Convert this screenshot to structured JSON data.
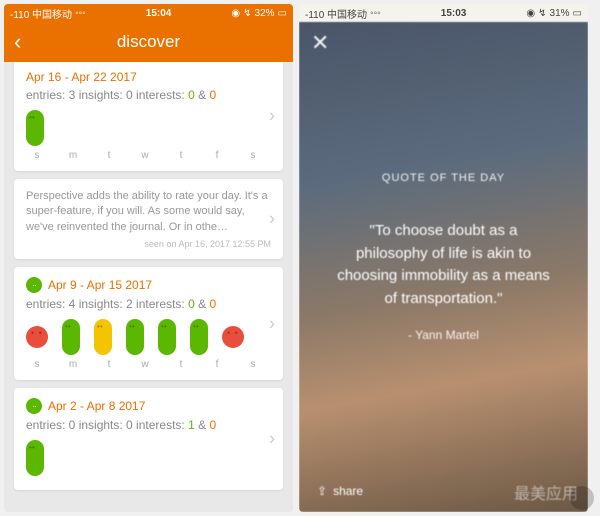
{
  "sb1": {
    "carrier": "-110 中国移动",
    "wifi": "⌃",
    "time": "15:04",
    "loc": "◉",
    "batt": "32%"
  },
  "sb2": {
    "carrier": "-110 中国移动",
    "wifi": "⌃",
    "time": "15:03",
    "loc": "◉",
    "batt": "31%"
  },
  "nav": {
    "title": "discover"
  },
  "w1": {
    "date": "Apr 16 - Apr 22 2017",
    "stats_a": "entries: 3   insights: 0   interests: ",
    "g": "0",
    "amp": " & ",
    "o": "0"
  },
  "dow": [
    "s",
    "m",
    "t",
    "w",
    "t",
    "f",
    "s"
  ],
  "tip": {
    "text": "Perspective adds the ability to rate your day. It's a super-feature, if you will. As some would say, we've reinvented the journal. Or in othe…",
    "seen": "seen on Apr 16, 2017 12:55 PM"
  },
  "w2": {
    "date": "Apr 9 - Apr 15 2017",
    "stats_a": "entries: 4   insights: 2   interests: ",
    "g": "0",
    "amp": " & ",
    "o": "0"
  },
  "w3": {
    "date": "Apr 2 - Apr 8 2017",
    "stats_a": "entries: 0   insights: 0   interests: ",
    "g": "1",
    "amp": " & ",
    "o": "0"
  },
  "quote": {
    "head": "QUOTE OF THE DAY",
    "body": "\"To choose doubt as a philosophy of life is akin to choosing immobility as a means of transportation.\"",
    "author": "- Yann Martel"
  },
  "share": "share",
  "wm": "最美应用"
}
